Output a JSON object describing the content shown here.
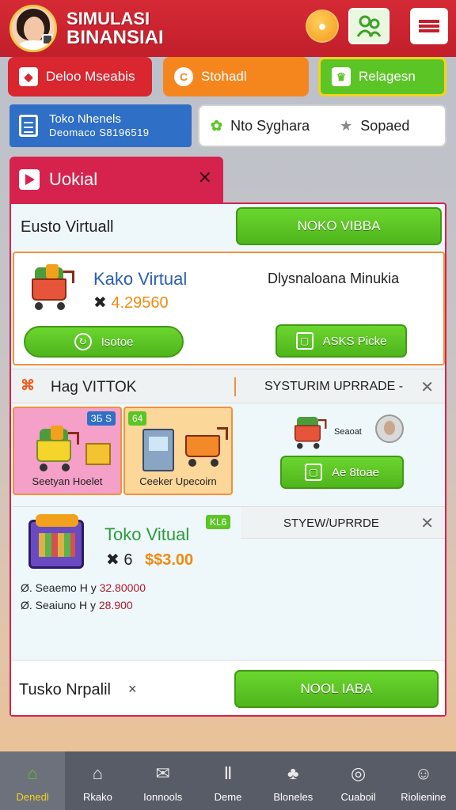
{
  "header": {
    "title_line1": "SIMULASI",
    "title_line2": "BINANSIAI",
    "coin_icon": "coin-icon",
    "friends_icon": "friends-icon",
    "menu_icon": "menu-icon"
  },
  "tabs": [
    {
      "label": "Deloo Mseabis",
      "icon": "diamond-icon"
    },
    {
      "label": "Stohadl",
      "icon": "coin-icon"
    },
    {
      "label": "Relagesn",
      "icon": "trophy-icon"
    }
  ],
  "info_bar": {
    "left_line1": "Toko Nhenels",
    "left_line2": "Deomaco S8196519",
    "right_label": "Nto Syghara",
    "right_label2": "Sopaed"
  },
  "panel": {
    "tab_label": "Uokial",
    "row1_label": "Eusto Virtuall",
    "row1_button": "NOKO VIBBA",
    "card1": {
      "name": "Kako Virtual",
      "price_prefix": "✖",
      "price_value": "4.29560",
      "right_label": "Dlysnaloana Minukia",
      "button1": "Isotoe",
      "button2": "ASKS Picke"
    },
    "row3": {
      "label": "Hag VITTOK",
      "label2": "SYSTURIM UPRRADE -",
      "close": "✕"
    },
    "tiles": [
      {
        "tag": "ЗБ S",
        "caption": "Seetyan Hoelet"
      },
      {
        "tag": "64",
        "caption": "Ceeker Upecoirn"
      }
    ],
    "right_area": {
      "small_label": "Seaoat",
      "button": "Ae 8toae"
    },
    "card3": {
      "name": "Toko Vitual",
      "tag": "KL6",
      "header_label": "STYEW/UPRRDE",
      "close": "✕",
      "price_prefix": "✖ 6",
      "price_value": "$$3.00",
      "stat1_prefix": "Ø. Seaemo H y",
      "stat1_value": "32.80000",
      "stat2_prefix": "Ø. Seaiuno H y",
      "stat2_value": "28.900"
    },
    "row_last": {
      "label": "Tusko Nrpalil",
      "close": "×",
      "button": "NOOL IABA"
    }
  },
  "bottom_nav": [
    {
      "label": "Denedl",
      "icon": "home-icon",
      "active": true
    },
    {
      "label": "Rkako",
      "icon": "house-icon"
    },
    {
      "label": "Ionnools",
      "icon": "mail-icon"
    },
    {
      "label": "Deme",
      "icon": "pillars-icon"
    },
    {
      "label": "Bloneles",
      "icon": "clover-icon"
    },
    {
      "label": "Cuaboil",
      "icon": "compass-icon"
    },
    {
      "label": "Riolienine",
      "icon": "profile-icon"
    }
  ]
}
